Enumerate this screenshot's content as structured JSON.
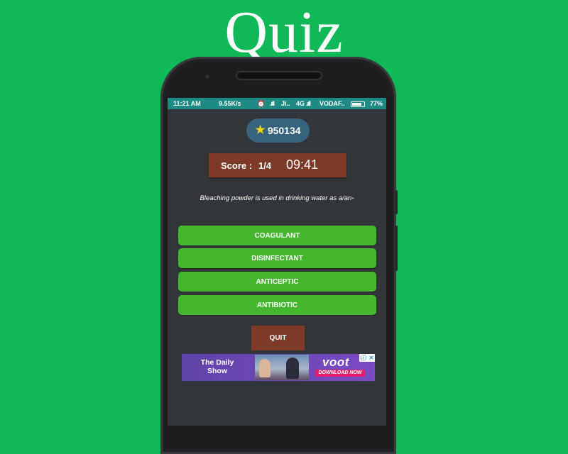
{
  "page_title": "Quiz",
  "status_bar": {
    "time": "11:21 AM",
    "speed": "9.55K/s",
    "carrier1": "Ji..",
    "network": "4G",
    "carrier2": "VODAF..",
    "battery": "77%"
  },
  "coins": {
    "icon": "star-icon",
    "value": "950134"
  },
  "score_panel": {
    "label": "Score :",
    "value": "1/4",
    "timer": "09:41"
  },
  "question": "Bleaching powder is used in drinking water as a/an-",
  "options": [
    {
      "label": "COAGULANT"
    },
    {
      "label": "DISINFECTANT"
    },
    {
      "label": "ANTICEPTIC"
    },
    {
      "label": "ANTIBIOTIC"
    }
  ],
  "quit_label": "QUIT",
  "ad": {
    "title": "The Daily Show",
    "brand": "voot",
    "cta": "DOWNLOAD NOW"
  },
  "colors": {
    "background": "#0fb957",
    "option_green": "#45b72f",
    "panel_brown": "#7d3a27",
    "badge_blue": "#37637f",
    "status_teal": "#1e8a84"
  }
}
